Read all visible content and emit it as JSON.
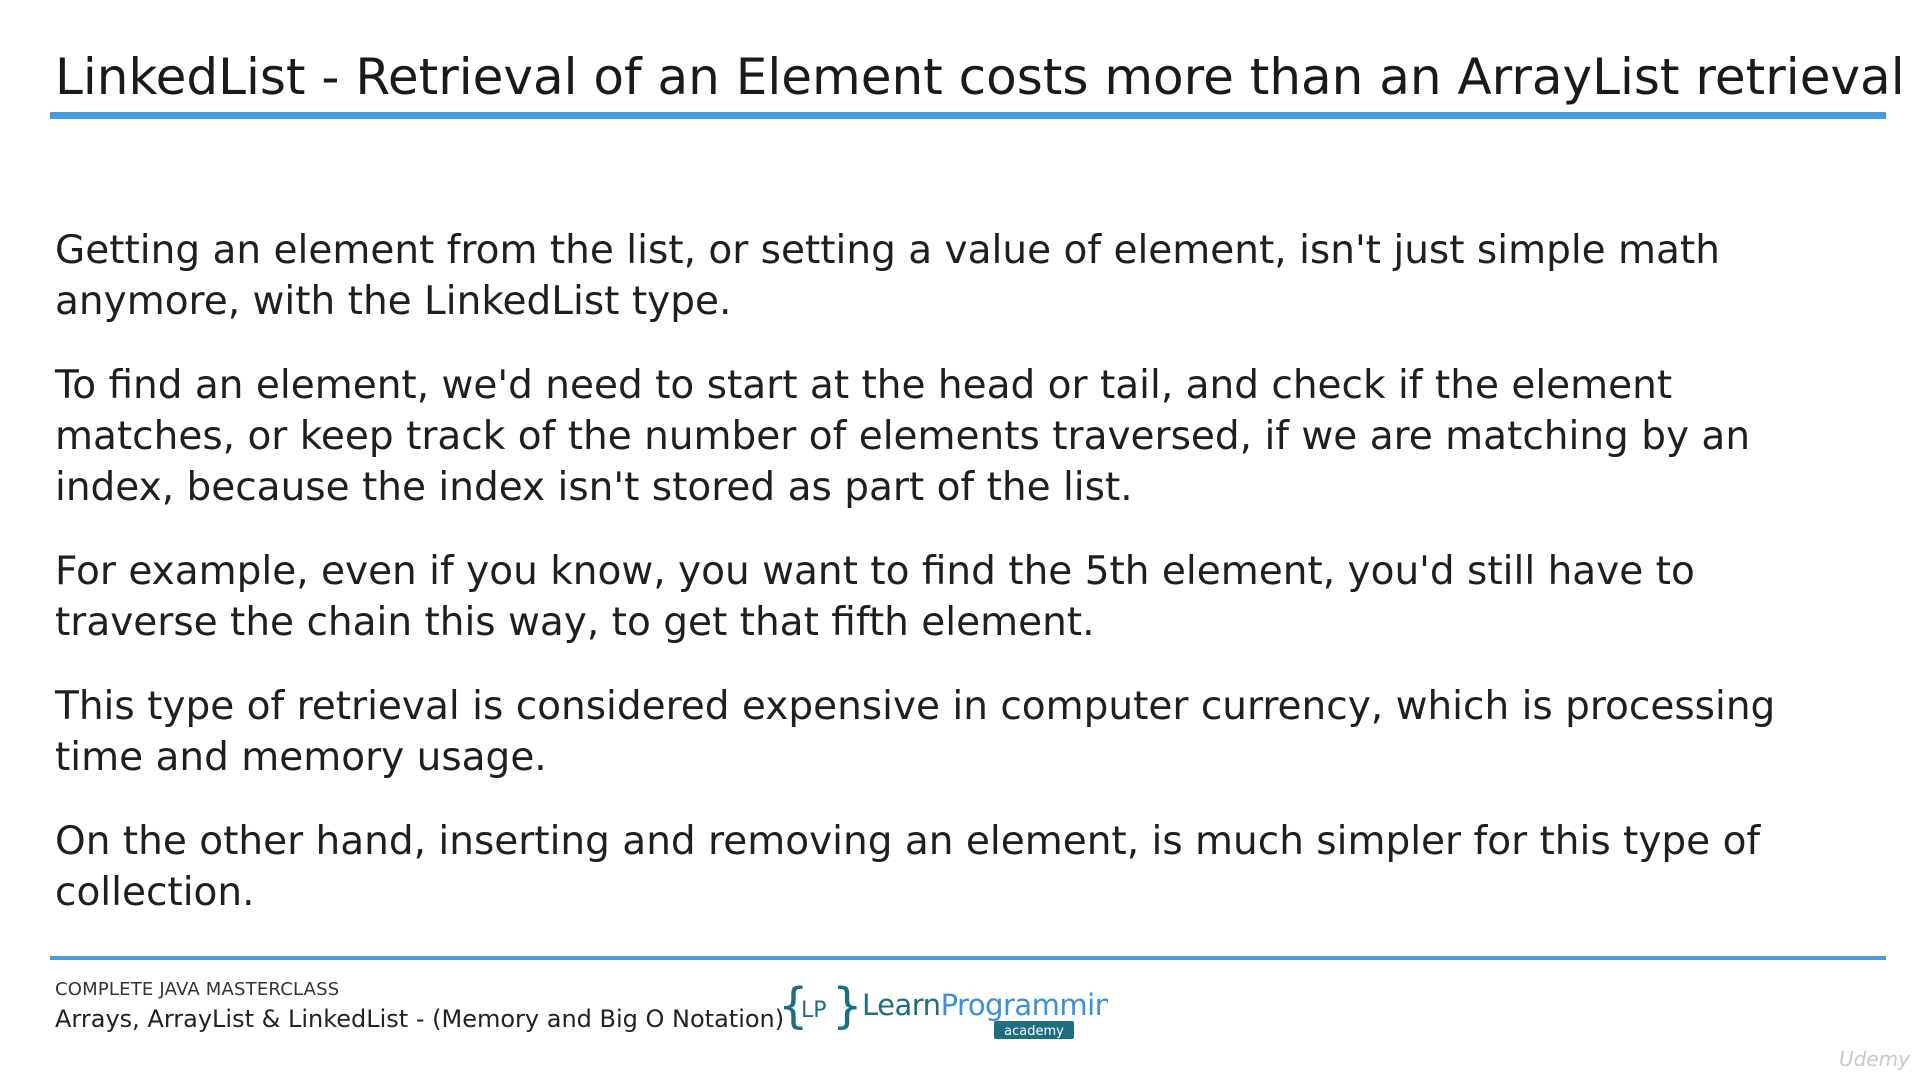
{
  "slide": {
    "title": "LinkedList - Retrieval of an Element costs more than an ArrayList retrieval",
    "paragraphs": [
      "Getting an element from the list, or setting a value of element, isn't just simple math anymore, with the LinkedList type.",
      "To find an element, we'd need to start at the head or tail, and check if the element matches, or keep track of the number of elements traversed, if we are matching by an index, because the index isn't stored as part of the list.",
      "For example, even if you know, you want to find the 5th element, you'd still have to traverse the chain this way, to get that fifth element.",
      "This type of retrieval is considered expensive in computer currency, which is processing time and memory usage.",
      "On the other hand, inserting and removing an element, is much simpler for this type of collection."
    ]
  },
  "footer": {
    "course": "COMPLETE JAVA MASTERCLASS",
    "section": "Arrays, ArrayList & LinkedList - (Memory and Big O Notation)"
  },
  "logo": {
    "icon": "learnprogramming-academy-logo",
    "initials": "LP",
    "word1": "Learn",
    "word2": "Programming",
    "tag": "academy"
  },
  "watermark": {
    "text": "Udemy"
  },
  "colors": {
    "accent": "#4a9be0",
    "logo_teal": "#1d6f80",
    "logo_blue": "#3a8fd6"
  }
}
